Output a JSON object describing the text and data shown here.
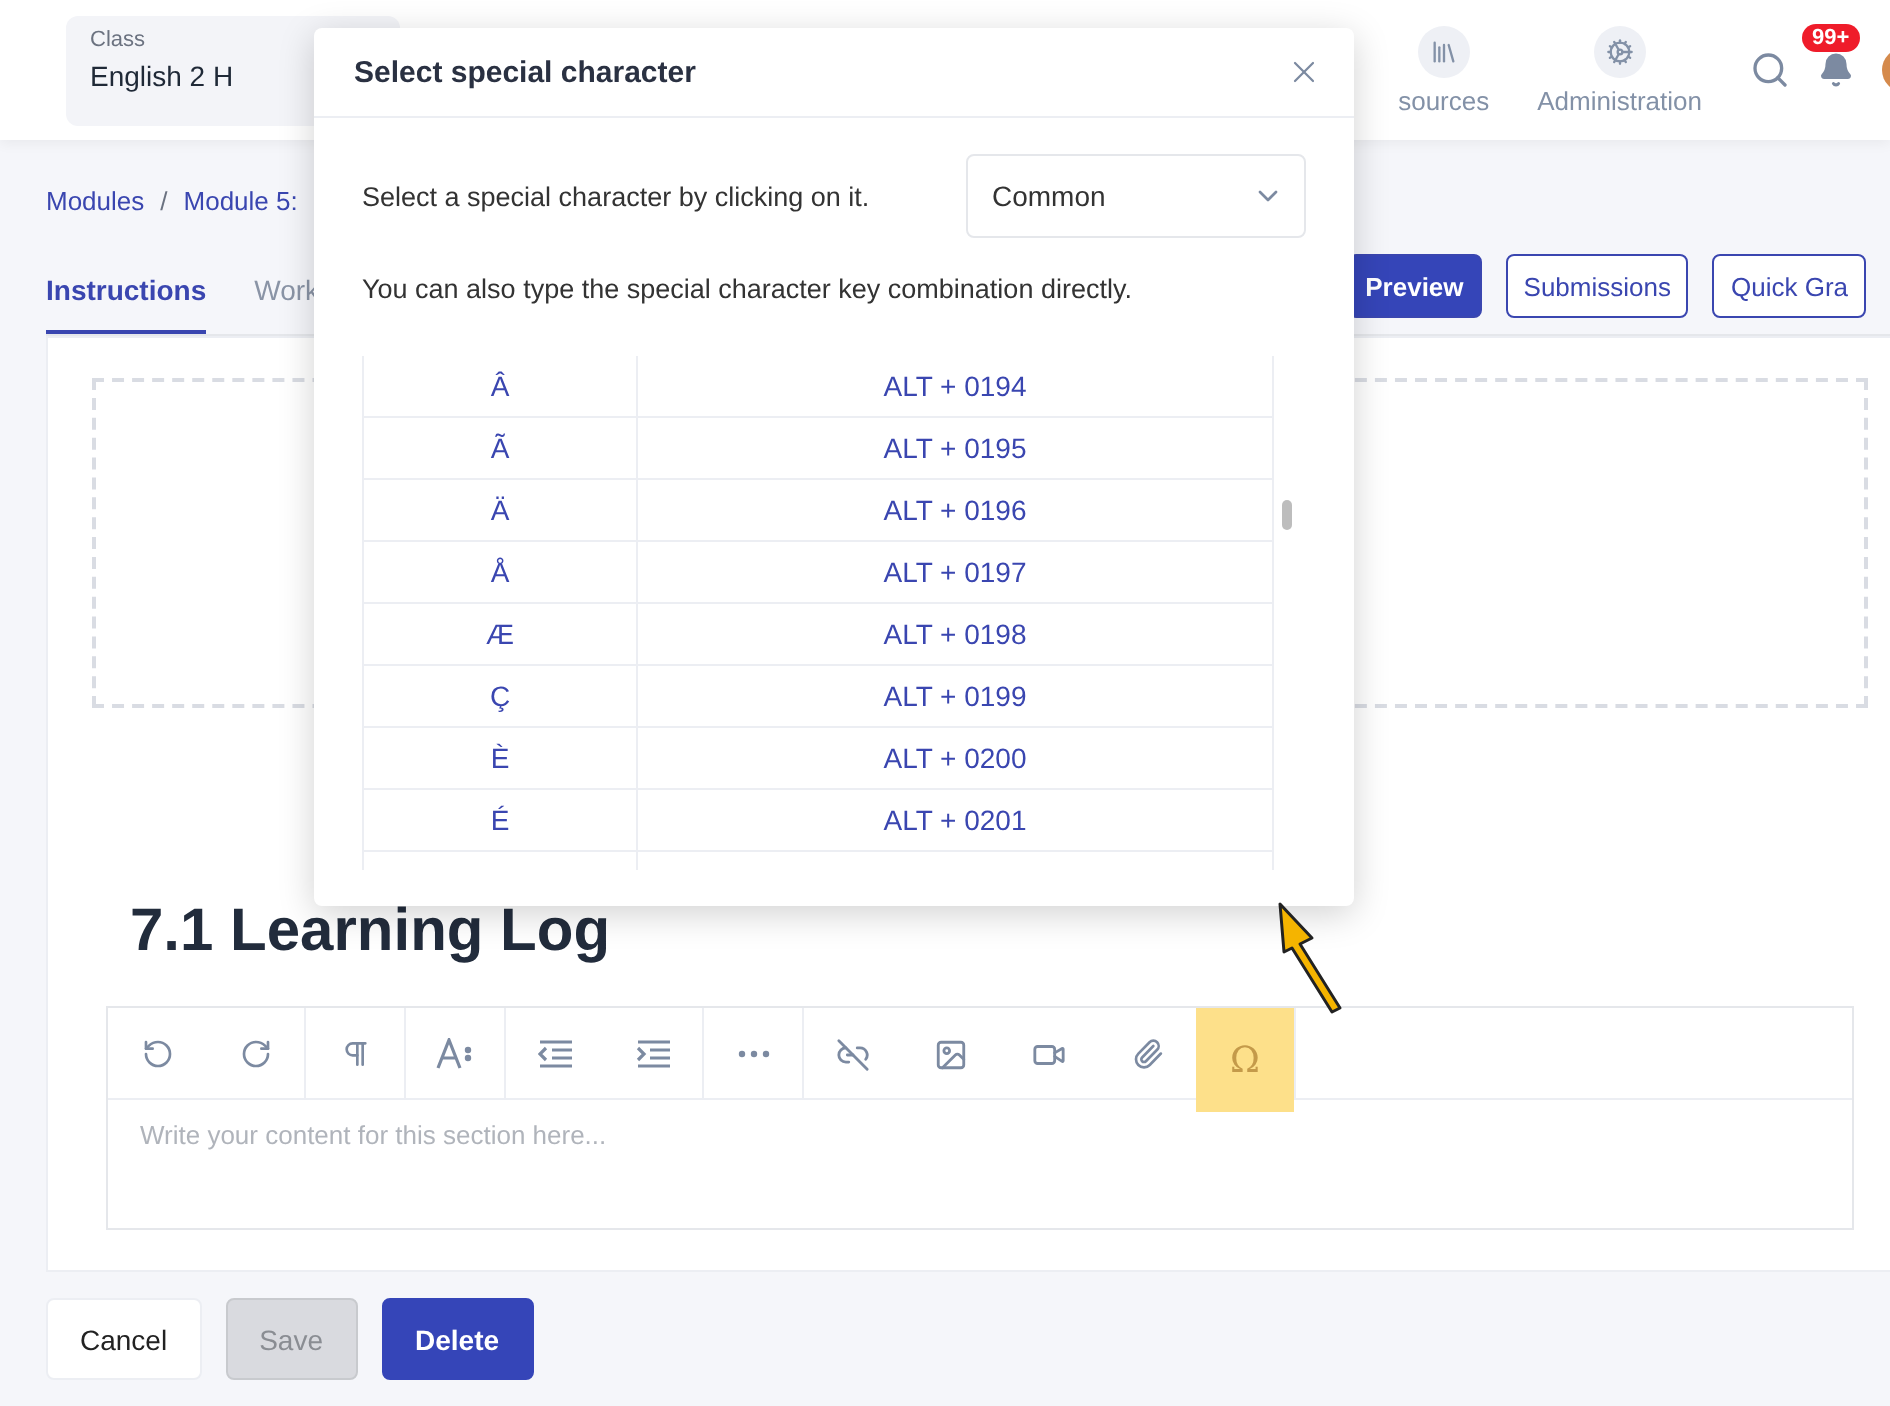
{
  "header": {
    "class_label": "Class",
    "class_value": "English 2 H",
    "nav": [
      {
        "label": "sources",
        "kind": "library"
      },
      {
        "label": "Administration",
        "kind": "cogs"
      }
    ],
    "notification_badge": "99+"
  },
  "breadcrumb": {
    "items": [
      "Modules",
      "Module 5:"
    ],
    "separator": "/"
  },
  "tabs": [
    {
      "label": "Instructions",
      "selected": true
    },
    {
      "label": "Work",
      "selected": false
    }
  ],
  "actions": [
    {
      "label": "Preview",
      "primary": true
    },
    {
      "label": "Submissions",
      "primary": false
    },
    {
      "label": "Quick Gra",
      "primary": false
    }
  ],
  "section_title": "7.1 Learning Log",
  "editor": {
    "special_button": {
      "label": "Ω",
      "highlighted": true
    },
    "placeholder": "Write your content for this section here..."
  },
  "footer_buttons": [
    {
      "label": "Cancel",
      "kind": "plain"
    },
    {
      "label": "Save",
      "kind": "disabled"
    },
    {
      "label": "Delete",
      "kind": "primary"
    }
  ],
  "dialog": {
    "title": "Select special character",
    "instruction": "Select a special character by clicking on it.",
    "category": "Common",
    "hint": "You can also type the special character key combination directly.",
    "rows": [
      {
        "char": "Â",
        "keys": "ALT + 0194"
      },
      {
        "char": "Ã",
        "keys": "ALT + 0195"
      },
      {
        "char": "Ä",
        "keys": "ALT + 0196"
      },
      {
        "char": "Å",
        "keys": "ALT + 0197"
      },
      {
        "char": "Æ",
        "keys": "ALT + 0198"
      },
      {
        "char": "Ç",
        "keys": "ALT + 0199"
      },
      {
        "char": "È",
        "keys": "ALT + 0200"
      },
      {
        "char": "É",
        "keys": "ALT + 0201"
      }
    ]
  }
}
